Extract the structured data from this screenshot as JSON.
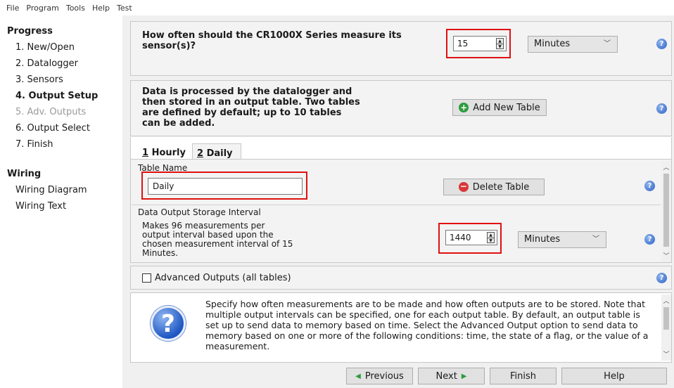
{
  "menu": [
    "File",
    "Program",
    "Tools",
    "Help",
    "Test"
  ],
  "sidebar": {
    "progress_heading": "Progress",
    "items": [
      {
        "label": "1. New/Open"
      },
      {
        "label": "2. Datalogger"
      },
      {
        "label": "3. Sensors"
      },
      {
        "label": "4. Output Setup"
      },
      {
        "label": "5. Adv. Outputs"
      },
      {
        "label": "6. Output Select"
      },
      {
        "label": "7. Finish"
      }
    ],
    "wiring_heading": "Wiring",
    "wiring_items": [
      {
        "label": "Wiring Diagram"
      },
      {
        "label": "Wiring Text"
      }
    ]
  },
  "measure": {
    "question": "How often should the CR1000X Series measure its sensor(s)?",
    "value": "15",
    "unit": "Minutes"
  },
  "tables_info": {
    "text": "Data is processed by the datalogger and then stored in an output table. Two tables are defined by default; up to 10 tables can be added.",
    "add_button": "Add New Table"
  },
  "tabs": [
    {
      "num": "1",
      "name": " Hourly"
    },
    {
      "num": "2",
      "name": " Daily"
    }
  ],
  "table": {
    "name_label": "Table Name",
    "name_value": "Daily",
    "delete_button": "Delete Table",
    "interval_label": "Data Output Storage Interval",
    "interval_desc": "Makes 96 measurements per output interval based upon the chosen measurement interval of 15 Minutes.",
    "interval_value": "1440",
    "interval_unit": "Minutes"
  },
  "advanced": {
    "label": "Advanced Outputs (all tables)",
    "checked": false
  },
  "help_text": "Specify how often measurements are to be made and how often outputs are to be stored. Note that multiple output intervals can be specified, one for each output table. By default, an output table is set up to send data to memory based on time. Select the Advanced Output option to send data to memory based on one or more of the following conditions: time, the state of a flag, or the value of a measurement.",
  "nav": {
    "previous": "Previous",
    "next": "Next",
    "finish": "Finish",
    "help": "Help"
  },
  "colors": {
    "highlight_box": "#e01010",
    "help_blue": "#2a5fc4"
  }
}
